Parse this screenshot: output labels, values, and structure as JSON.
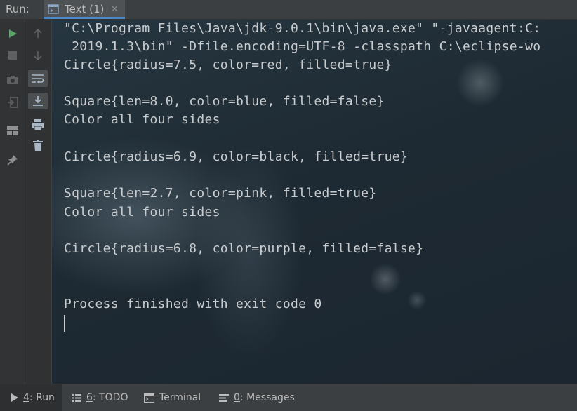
{
  "header": {
    "run_label": "Run:",
    "tab_title": "Text (1)",
    "tab_close": "×"
  },
  "console": {
    "lines": [
      "\"C:\\Program Files\\Java\\jdk-9.0.1\\bin\\java.exe\" \"-javaagent:C:",
      " 2019.1.3\\bin\" -Dfile.encoding=UTF-8 -classpath C:\\eclipse-wo",
      "Circle{radius=7.5, color=red, filled=true}",
      "",
      "Square{len=8.0, color=blue, filled=false}",
      "Color all four sides",
      "",
      "Circle{radius=6.9, color=black, filled=true}",
      "",
      "Square{len=2.7, color=pink, filled=true}",
      "Color all four sides",
      "",
      "Circle{radius=6.8, color=purple, filled=false}",
      "",
      "",
      "Process finished with exit code 0"
    ]
  },
  "toolbar": {
    "left": [
      "play-icon",
      "stop-icon",
      "camera-icon",
      "exit-icon",
      "layout-icon",
      "pin-icon"
    ],
    "right": [
      "up-arrow-icon",
      "down-arrow-icon",
      "soft-wrap-icon",
      "scroll-to-end-icon",
      "print-icon",
      "trash-icon"
    ]
  },
  "bottom_tabs": [
    {
      "mnemonic": "4",
      "label": ": Run",
      "icon": "run-icon"
    },
    {
      "mnemonic": "6",
      "label": ": TODO",
      "icon": "todo-icon"
    },
    {
      "mnemonic": "",
      "label": "Terminal",
      "icon": "terminal-icon"
    },
    {
      "mnemonic": "0",
      "label": ": Messages",
      "icon": "messages-icon"
    }
  ],
  "colors": {
    "accent": "#4a88c7",
    "play": "#59a869",
    "console_text": "#c9ccce"
  }
}
